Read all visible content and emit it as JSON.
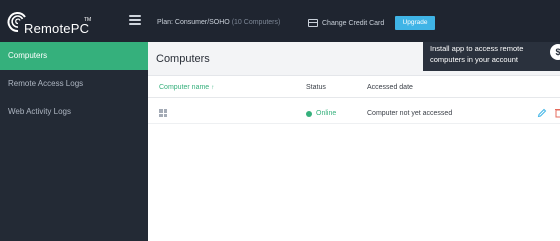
{
  "app": {
    "logo_text": "RemotePC",
    "logo_tm": "TM"
  },
  "topbar": {
    "plan_label": "Plan: Consumer/SOHO",
    "plan_detail": "(10 Computers)",
    "change_card_label": "Change Credit Card",
    "upgrade_label": "Upgrade"
  },
  "sidebar": {
    "items": [
      {
        "label": "Computers",
        "active": true
      },
      {
        "label": "Remote Access Logs",
        "active": false
      },
      {
        "label": "Web Activity Logs",
        "active": false
      }
    ]
  },
  "main": {
    "title": "Computers",
    "tip": {
      "text": "Install app to access remote computers in your account",
      "icon": "$"
    },
    "columns": {
      "name": "Computer name",
      "status": "Status",
      "accessed": "Accessed date"
    },
    "rows": [
      {
        "os_icon": "windows-icon",
        "name": "",
        "status": "Online",
        "accessed": "Computer not yet accessed"
      }
    ]
  },
  "colors": {
    "accent_green": "#35b07c",
    "upgrade_blue": "#3fb4e6",
    "topbar_bg": "#1f2530",
    "sidebar_bg": "#232a35"
  }
}
